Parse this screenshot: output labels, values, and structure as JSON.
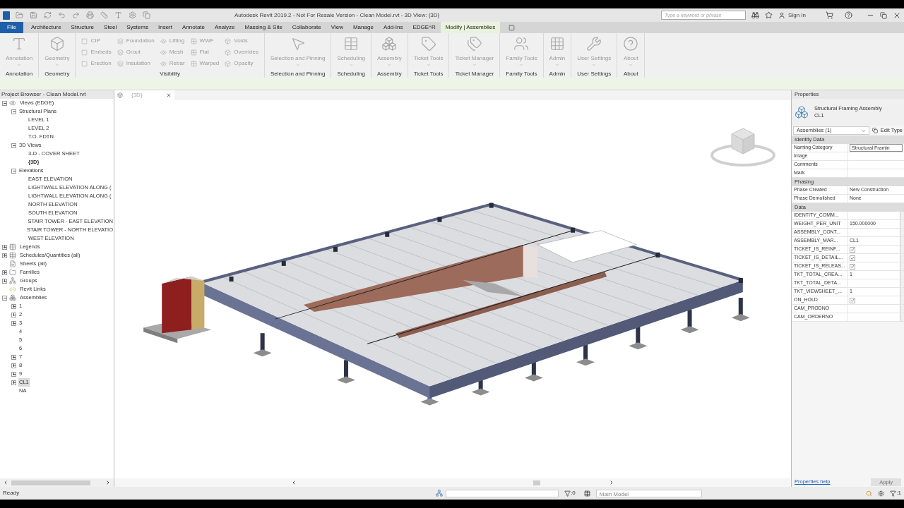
{
  "window": {
    "title": "Autodesk Revit 2019.2 - Not For Resale Version - Clean Model.rvt - 3D View: {3D}",
    "search_placeholder": "Type a keyword or phrase",
    "sign_in": "Sign In"
  },
  "tabs": [
    {
      "label": "File",
      "kind": "application",
      "selected": false
    },
    {
      "label": "Architecture",
      "kind": "tab",
      "selected": false
    },
    {
      "label": "Structure",
      "kind": "tab",
      "selected": false
    },
    {
      "label": "Steel",
      "kind": "tab",
      "selected": false
    },
    {
      "label": "Systems",
      "kind": "tab",
      "selected": false
    },
    {
      "label": "Insert",
      "kind": "tab",
      "selected": false
    },
    {
      "label": "Annotate",
      "kind": "tab",
      "selected": false
    },
    {
      "label": "Analyze",
      "kind": "tab",
      "selected": false
    },
    {
      "label": "Massing & Site",
      "kind": "tab",
      "selected": false
    },
    {
      "label": "Collaborate",
      "kind": "tab",
      "selected": false
    },
    {
      "label": "View",
      "kind": "tab",
      "selected": false
    },
    {
      "label": "Manage",
      "kind": "tab",
      "selected": false
    },
    {
      "label": "Add-Ins",
      "kind": "tab",
      "selected": false
    },
    {
      "label": "EDGE^R",
      "kind": "tab",
      "selected": false
    },
    {
      "label": "Modify | Assemblies",
      "kind": "contextual",
      "selected": true
    }
  ],
  "ribbon": [
    {
      "panel": "Annotation",
      "kind": "large",
      "button": "Annotation"
    },
    {
      "panel": "Geometry",
      "kind": "large",
      "button": "Geometry"
    },
    {
      "panel": "Visibility",
      "kind": "small",
      "items": [
        "CIP",
        "Embeds",
        "Erection",
        "Foundation",
        "Grout",
        "Insulation",
        "Lifting",
        "Mesh",
        "Rebar",
        "WWF",
        "Flat",
        "Warped",
        "Voids",
        "Overrides",
        "Opacity"
      ]
    },
    {
      "panel": "Selection and Pinning",
      "kind": "large",
      "button": "Selection and Pinning"
    },
    {
      "panel": "Scheduling",
      "kind": "large",
      "button": "Scheduling"
    },
    {
      "panel": "Assembly",
      "kind": "large",
      "button": "Assembly"
    },
    {
      "panel": "Ticket Tools",
      "kind": "large",
      "button": "Ticket Tools"
    },
    {
      "panel": "Ticket Manager",
      "kind": "large",
      "button": "Ticket Manager"
    },
    {
      "panel": "Family Tools",
      "kind": "large",
      "button": "Family Tools"
    },
    {
      "panel": "Admin",
      "kind": "large",
      "button": "Admin"
    },
    {
      "panel": "User Settings",
      "kind": "large",
      "button": "User Settings"
    },
    {
      "panel": "About",
      "kind": "large",
      "button": "About"
    }
  ],
  "project_browser": {
    "title": "Project Browser - Clean Model.rvt",
    "tree": [
      {
        "label": "Views (EDGE)",
        "kind": "views",
        "selected": false,
        "expanded": true,
        "children": [
          {
            "label": "Structural Plans",
            "selected": false,
            "expanded": true,
            "children": [
              {
                "label": "LEVEL 1",
                "selected": false
              },
              {
                "label": "LEVEL 2",
                "selected": false
              },
              {
                "label": "T.O. FDTN",
                "selected": false
              }
            ]
          },
          {
            "label": "3D Views",
            "selected": false,
            "expanded": true,
            "children": [
              {
                "label": "3-D - COVER SHEET",
                "selected": false,
                "current": false
              },
              {
                "label": "{3D}",
                "selected": false,
                "current": true
              }
            ]
          },
          {
            "label": "Elevations",
            "selected": false,
            "expanded": true,
            "children": [
              {
                "label": "EAST ELEVATION",
                "selected": false
              },
              {
                "label": "LIGHTWALL ELEVATION ALONG (",
                "selected": false
              },
              {
                "label": "LIGHTWALL ELEVATION ALONG (",
                "selected": false
              },
              {
                "label": "NORTH ELEVATION",
                "selected": false
              },
              {
                "label": "SOUTH ELEVATION",
                "selected": false
              },
              {
                "label": "STAIR TOWER - EAST ELEVATION",
                "selected": false
              },
              {
                "label": "STAIR TOWER - NORTH ELEVATIO",
                "selected": false
              },
              {
                "label": "WEST ELEVATION",
                "selected": false
              }
            ]
          }
        ]
      },
      {
        "label": "Legends",
        "kind": "legends",
        "selected": false,
        "expanded": false
      },
      {
        "label": "Schedules/Quantities (all)",
        "kind": "schedules",
        "selected": false,
        "expanded": false
      },
      {
        "label": "Sheets (all)",
        "kind": "sheets",
        "selected": false
      },
      {
        "label": "Families",
        "kind": "families",
        "selected": false,
        "expanded": false
      },
      {
        "label": "Groups",
        "kind": "groups",
        "selected": false,
        "expanded": false
      },
      {
        "label": "Revit Links",
        "kind": "links",
        "selected": false
      },
      {
        "label": "Assemblies",
        "kind": "assemblies",
        "selected": false,
        "expanded": true,
        "children": [
          {
            "label": "1",
            "selected": false,
            "expanded": false
          },
          {
            "label": "2",
            "selected": false,
            "expanded": false
          },
          {
            "label": "3",
            "selected": false,
            "expanded": false
          },
          {
            "label": "4",
            "selected": false
          },
          {
            "label": "5",
            "selected": false
          },
          {
            "label": "6",
            "selected": false
          },
          {
            "label": "7",
            "selected": false,
            "expanded": false
          },
          {
            "label": "8",
            "selected": false,
            "expanded": false
          },
          {
            "label": "9",
            "selected": false,
            "expanded": false
          },
          {
            "label": "CL1",
            "selected": true,
            "expanded": false
          },
          {
            "label": "NA",
            "selected": false
          }
        ]
      }
    ]
  },
  "view_tab": {
    "label": "{3D}"
  },
  "properties": {
    "title": "Properties",
    "type_name": "Structural Framing Assembly",
    "type_sub": "CL1",
    "filter": "Assemblies (1)",
    "edit_type": "Edit Type",
    "help": "Properties help",
    "apply": "Apply",
    "groups": [
      {
        "name": "Identity Data",
        "rows": [
          {
            "name": "Naming Category",
            "kind": "field",
            "value": "Structural Framin"
          },
          {
            "name": "Image",
            "kind": "text",
            "value": ""
          },
          {
            "name": "Comments",
            "kind": "text",
            "value": ""
          },
          {
            "name": "Mark",
            "kind": "text",
            "value": ""
          }
        ]
      },
      {
        "name": "Phasing",
        "rows": [
          {
            "name": "Phase Created",
            "kind": "text",
            "value": "New Construction"
          },
          {
            "name": "Phase Demolished",
            "kind": "text",
            "value": "None"
          }
        ]
      },
      {
        "name": "Data",
        "rows": [
          {
            "name": "IDENTITY_COMM...",
            "kind": "text",
            "value": ""
          },
          {
            "name": "WEIGHT_PER_UNIT",
            "kind": "text",
            "value": "150.000000"
          },
          {
            "name": "ASSEMBLY_CONT...",
            "kind": "text",
            "value": ""
          },
          {
            "name": "ASSEMBLY_MAR...",
            "kind": "text",
            "value": "CL1"
          },
          {
            "name": "TICKET_IS_REINF...",
            "kind": "checkbox",
            "checked": true
          },
          {
            "name": "TICKET_IS_DETAIL...",
            "kind": "checkbox",
            "checked": true
          },
          {
            "name": "TICKET_IS_RELEAS...",
            "kind": "checkbox",
            "checked": true
          },
          {
            "name": "TKT_TOTAL_CREA...",
            "kind": "text",
            "value": "1"
          },
          {
            "name": "TKT_TOTAL_DETA...",
            "kind": "text",
            "value": ""
          },
          {
            "name": "TKT_VIEWSHEET_...",
            "kind": "text",
            "value": "1"
          },
          {
            "name": "ON_HOLD",
            "kind": "checkbox",
            "checked": true
          },
          {
            "name": "CAM_PRODNO",
            "kind": "text",
            "value": ""
          },
          {
            "name": "CAM_ORDERNO",
            "kind": "text",
            "value": ""
          }
        ]
      }
    ]
  },
  "status_bar": {
    "text": "Ready",
    "selection_count": ":0",
    "model": "Main Model",
    "filter_count": ":1"
  }
}
